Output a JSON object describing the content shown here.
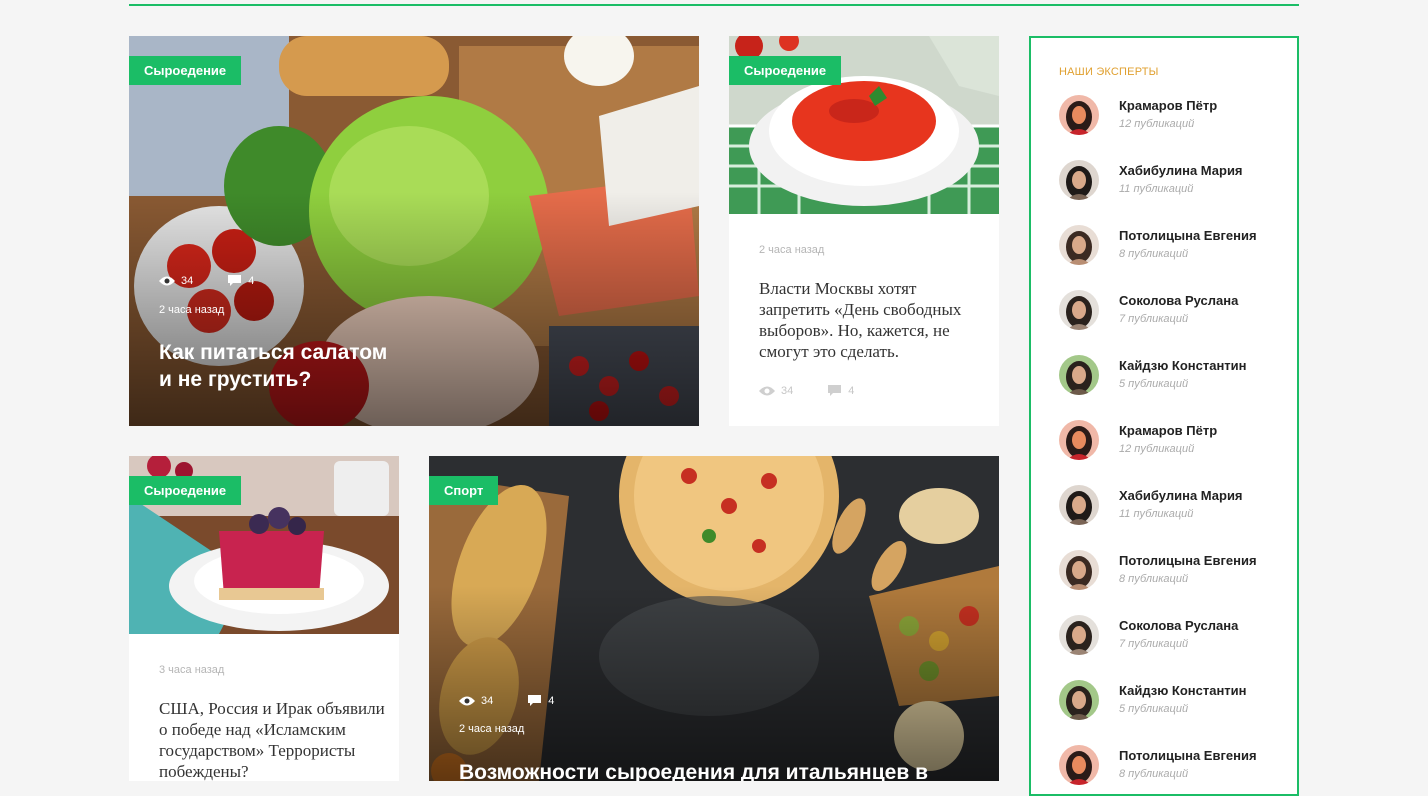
{
  "colors": {
    "accent": "#1bbd66",
    "experts_title": "#e0a030",
    "background": "#f5f5f5"
  },
  "icons": {
    "views": "eye-icon",
    "comments": "comment-icon"
  },
  "cards": {
    "salad": {
      "tag": "Сыроедение",
      "views": "34",
      "comments": "4",
      "time": "2 часа назад",
      "title_line1": "Как питаться салатом",
      "title_line2": "и не грустить?"
    },
    "soup": {
      "tag": "Сыроедение",
      "time": "2 часа назад",
      "title": "Власти Москвы хотят запретить «День свободных выборов». Но, кажется, не смогут это сделать.",
      "views": "34",
      "comments": "4"
    },
    "cake": {
      "tag": "Сыроедение",
      "time": "3 часа назад",
      "title": "США, Россия и Ирак объявили о победе над «Исламским государством» Террористы побеждены?"
    },
    "pizza": {
      "tag": "Спорт",
      "views": "34",
      "comments": "4",
      "time": "2 часа назад",
      "title": "Возможности сыроедения для итальянцев в"
    }
  },
  "experts": {
    "title": "НАШИ ЭКСПЕРТЫ",
    "items": [
      {
        "name": "Крамаров Пётр",
        "count": "12 публикаций"
      },
      {
        "name": "Хабибулина Мария",
        "count": "11 публикаций"
      },
      {
        "name": "Потолицына Евгения",
        "count": "8 публикаций"
      },
      {
        "name": "Соколова Руслана",
        "count": "7 публикаций"
      },
      {
        "name": "Кайдзю Константин",
        "count": "5 публикаций"
      },
      {
        "name": "Крамаров Пётр",
        "count": "12 публикаций"
      },
      {
        "name": "Хабибулина Мария",
        "count": "11 публикаций"
      },
      {
        "name": "Потолицына Евгения",
        "count": "8 публикаций"
      },
      {
        "name": "Соколова Руслана",
        "count": "7 публикаций"
      },
      {
        "name": "Кайдзю Константин",
        "count": "5 публикаций"
      },
      {
        "name": "Потолицына Евгения",
        "count": "8 публикаций"
      }
    ]
  }
}
